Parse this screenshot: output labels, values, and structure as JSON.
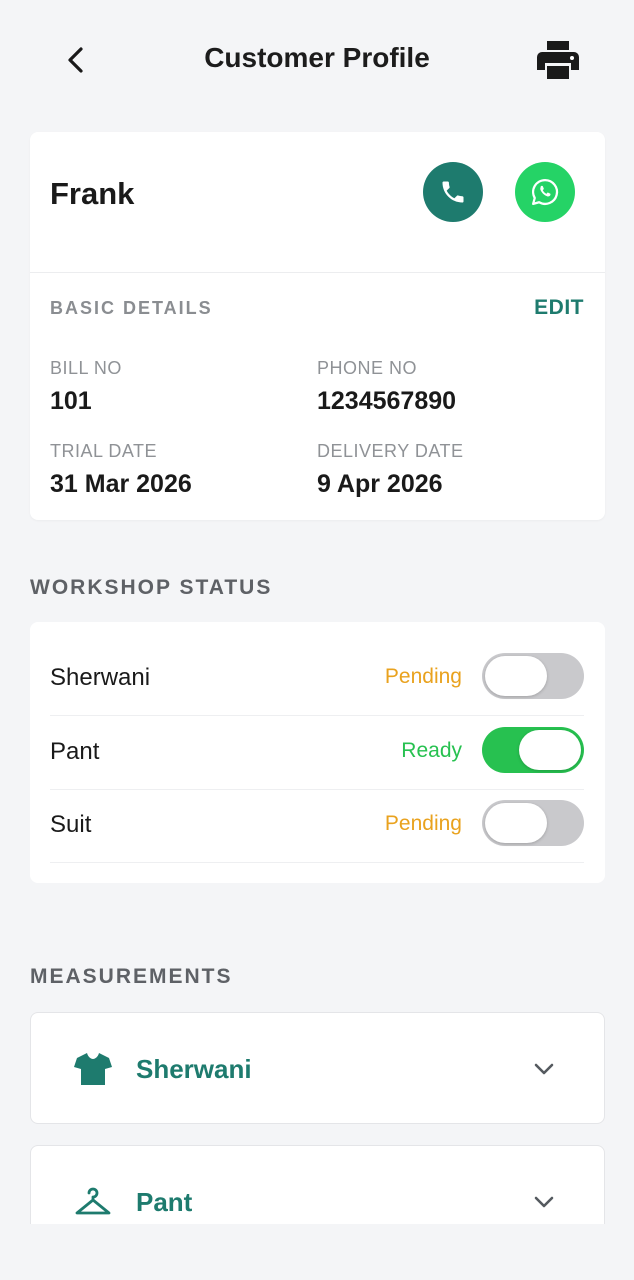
{
  "header": {
    "title": "Customer Profile",
    "back_icon": "chevron-left-icon",
    "print_icon": "printer-icon"
  },
  "customer": {
    "name": "Frank",
    "call_icon": "phone-icon",
    "whatsapp_icon": "whatsapp-icon"
  },
  "basic_details": {
    "title": "BASIC DETAILS",
    "edit_label": "EDIT",
    "bill_no_label": "BILL NO",
    "bill_no": "101",
    "phone_no_label": "PHONE NO",
    "phone_no": "1234567890",
    "trial_date_label": "TRIAL DATE",
    "trial_date": "31 Mar 2026",
    "delivery_date_label": "DELIVERY DATE",
    "delivery_date": "9 Apr 2026"
  },
  "workshop": {
    "title": "WORKSHOP STATUS",
    "items": [
      {
        "name": "Sherwani",
        "status": "Pending",
        "ready": false
      },
      {
        "name": "Pant",
        "status": "Ready",
        "ready": true
      },
      {
        "name": "Suit",
        "status": "Pending",
        "ready": false
      }
    ]
  },
  "measurements": {
    "title": "MEASUREMENTS",
    "items": [
      {
        "label": "Sherwani",
        "icon": "shirt-icon"
      },
      {
        "label": "Pant",
        "icon": "hanger-icon"
      }
    ]
  },
  "colors": {
    "accent": "#1E7B6E",
    "whatsapp": "#25D366",
    "pending": "#E9A21E",
    "ready": "#27C150"
  }
}
